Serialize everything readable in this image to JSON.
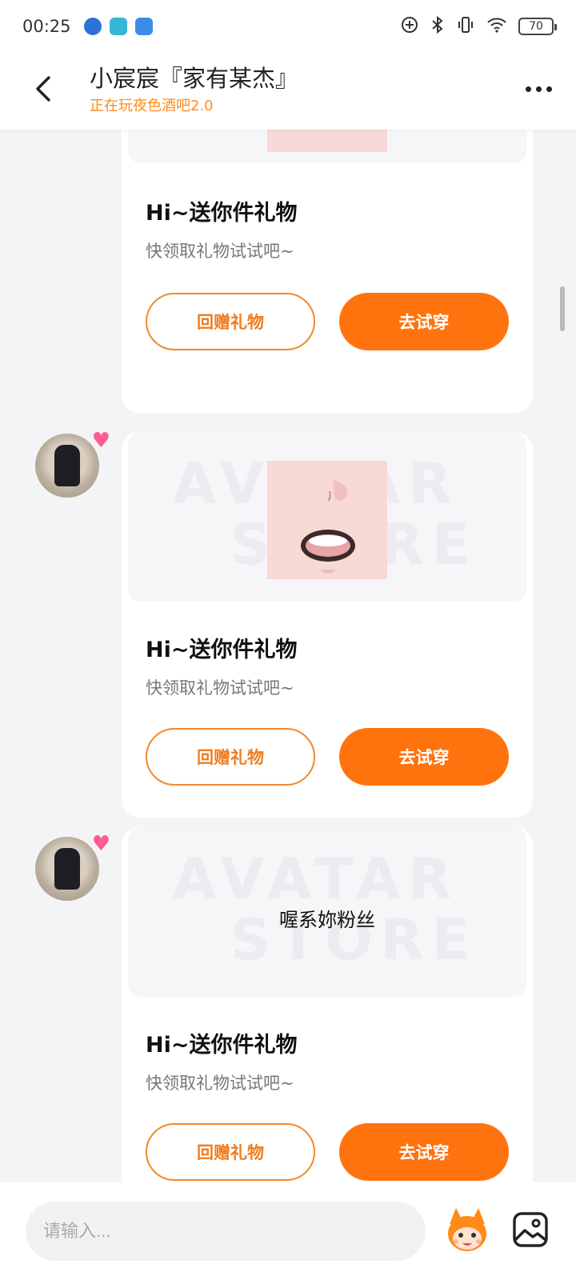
{
  "status_bar": {
    "time": "00:25",
    "battery": "70",
    "app_icon_colors": [
      "#2d73d6",
      "#33b6d8",
      "#3a8de6"
    ]
  },
  "header": {
    "title": "小宸宸『家有某杰』",
    "subtitle": "正在玩夜色酒吧2.0"
  },
  "messages": [
    {
      "avatar": false,
      "image_type": "face-fangs",
      "title": "Hi~送你件礼物",
      "desc": "快领取礼物试试吧~",
      "btn_return": "回赠礼物",
      "btn_try": "去试穿"
    },
    {
      "avatar": true,
      "image_type": "face-mouth",
      "watermark": [
        "AVATAR",
        "STORE"
      ],
      "title": "Hi~送你件礼物",
      "desc": "快领取礼物试试吧~",
      "btn_return": "回赠礼物",
      "btn_try": "去试穿"
    },
    {
      "avatar": true,
      "image_type": "text",
      "image_text": "喔系妳粉丝",
      "watermark": [
        "AVATAR",
        "STORE"
      ],
      "title": "Hi~送你件礼物",
      "desc": "快领取礼物试试吧~",
      "btn_return": "回赠礼物",
      "btn_try": "去试穿"
    }
  ],
  "input": {
    "placeholder": "请输入..."
  },
  "colors": {
    "accent": "#ff730f",
    "subtitle": "#ff8a1a"
  },
  "icons": [
    "back-arrow-icon",
    "more-icon",
    "emoji-mascot-icon",
    "image-icon",
    "bluetooth-icon",
    "wifi-icon",
    "vibrate-icon",
    "data-saver-icon"
  ]
}
